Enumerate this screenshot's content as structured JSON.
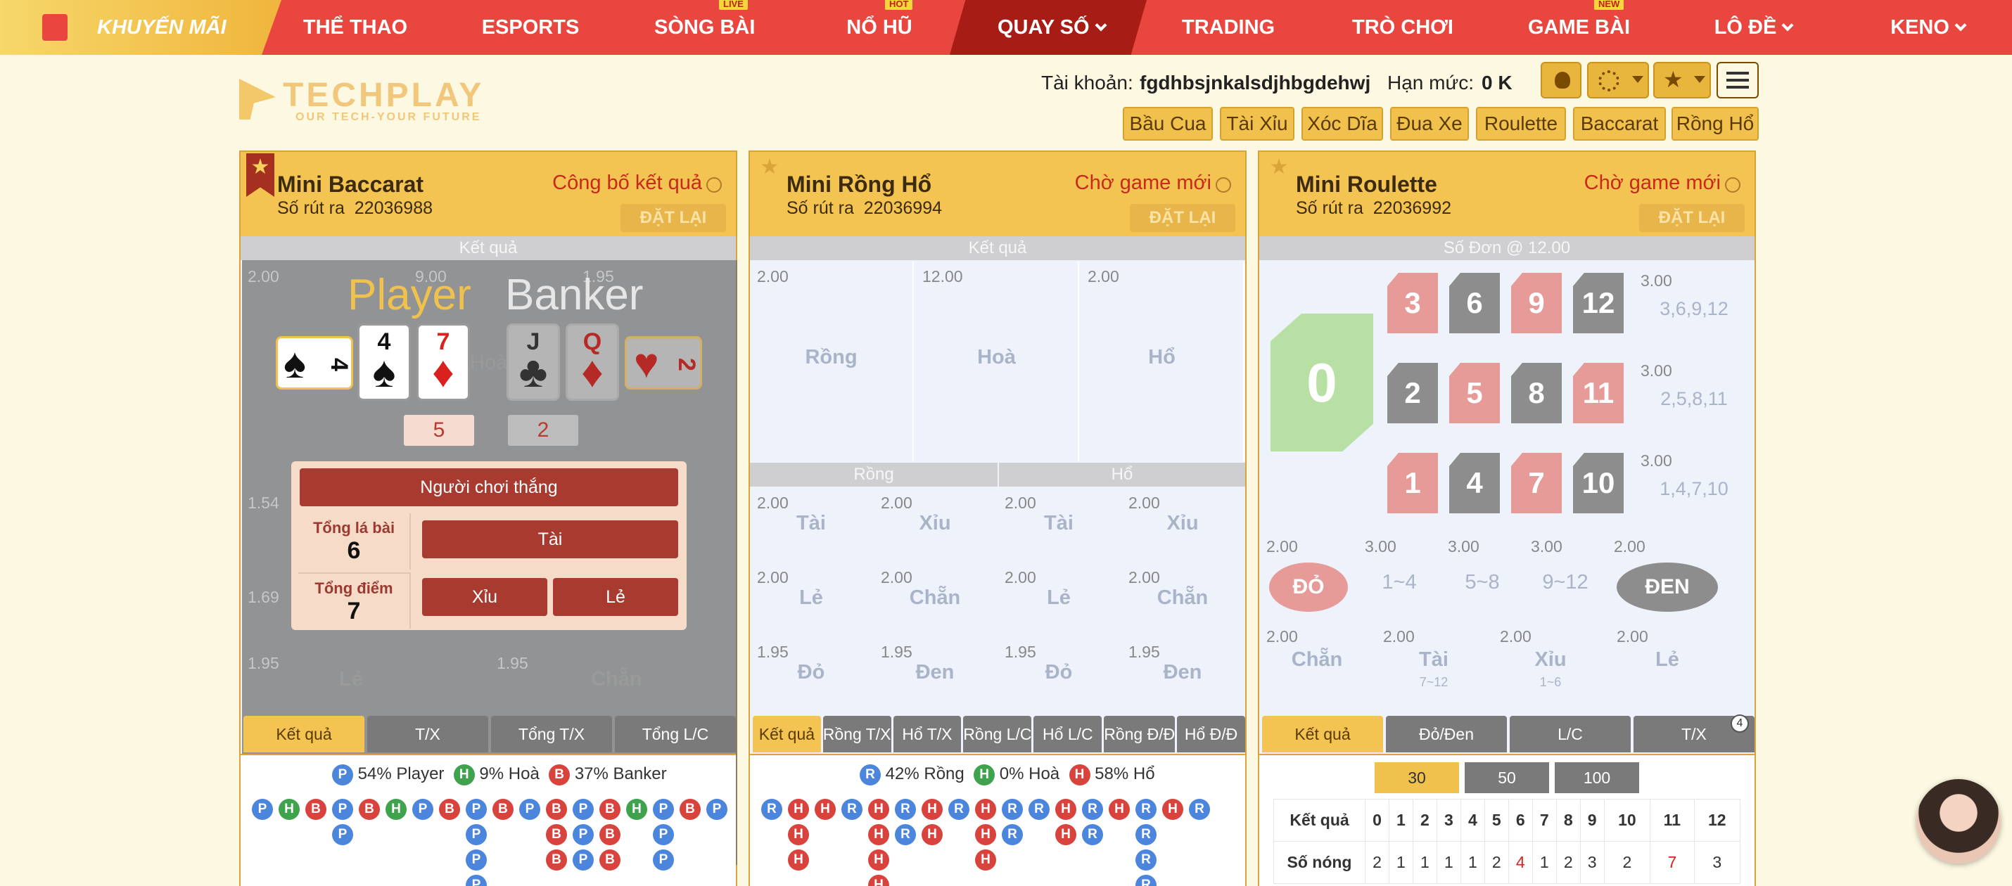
{
  "nav": {
    "promo": "KHUYẾN MÃI",
    "items": [
      "THỂ THAO",
      "ESPORTS",
      "SÒNG BÀI",
      "NỔ HŨ",
      "QUAY SỐ",
      "TRADING",
      "TRÒ CHƠI",
      "GAME BÀI",
      "LÔ ĐỀ",
      "KENO"
    ],
    "badges": {
      "live": "LIVE",
      "hot": "HOT",
      "new": "NEW"
    }
  },
  "logo": {
    "name": "TECHPLAY",
    "tagline": "OUR TECH-YOUR FUTURE"
  },
  "account": {
    "label": "Tài khoản:",
    "username": "fgdhbsjnkalsdjhbgdehwj",
    "limit_label": "Hạn mức:",
    "limit_value": "0 K"
  },
  "games": [
    "Bầu Cua",
    "Tài Xỉu",
    "Xóc Dĩa",
    "Đua Xe",
    "Roulette",
    "Baccarat",
    "Rồng Hổ"
  ],
  "baccarat": {
    "title": "Mini Baccarat",
    "round_label": "Số rút ra",
    "round": "22036988",
    "status": "Công bố kết quả",
    "reset": "ĐẶT LẠI",
    "result_bar": "Kết quả",
    "odds_top": [
      "2.00",
      "9.00",
      "1.95"
    ],
    "player": "Player",
    "banker": "Banker",
    "player_cards": [
      {
        "rank": "4",
        "suit": "♠",
        "color": "blk"
      },
      {
        "rank": "4",
        "suit": "♠",
        "color": "blk"
      },
      {
        "rank": "7",
        "suit": "♦",
        "color": "red"
      }
    ],
    "banker_cards": [
      {
        "rank": "J",
        "suit": "♣",
        "color": "blk"
      },
      {
        "rank": "Q",
        "suit": "♦",
        "color": "red"
      },
      {
        "rank": "2",
        "suit": "♥",
        "color": "red"
      }
    ],
    "player_score": "5",
    "banker_score": "2",
    "hoa_label": "Hoà",
    "odds_mid": [
      "1.54",
      "1.69"
    ],
    "odds_bottom": [
      "1.95",
      "1.95"
    ],
    "bottom_labels": [
      "Lẻ",
      "Chẵn"
    ],
    "popup": {
      "winner": "Người chơi thắng",
      "cards_label": "Tổng lá bài",
      "cards_value": "6",
      "points_label": "Tổng điểm",
      "points_value": "7",
      "tai": "Tài",
      "xiu": "Xỉu",
      "le": "Lẻ"
    },
    "tabs": [
      "Kết quả",
      "T/X",
      "Tổng T/X",
      "Tổng L/C"
    ],
    "stats": {
      "p_badge": "P",
      "p": "54% Player",
      "h_badge": "H",
      "h": "9% Hoà",
      "b_badge": "B",
      "b": "37% Banker"
    }
  },
  "dragon": {
    "title": "Mini Rồng Hổ",
    "round_label": "Số rút ra",
    "round": "22036994",
    "status": "Chờ game mới",
    "reset": "ĐẶT LẠI",
    "result_bar": "Kết quả",
    "main": [
      {
        "odd": "2.00",
        "label": "Rồng"
      },
      {
        "odd": "12.00",
        "label": "Hoà"
      },
      {
        "odd": "2.00",
        "label": "Hổ"
      }
    ],
    "sub_heads": [
      "Rồng",
      "Hổ"
    ],
    "sub_rows": [
      [
        {
          "odd": "2.00",
          "label": "Tài"
        },
        {
          "odd": "2.00",
          "label": "Xỉu"
        },
        {
          "odd": "2.00",
          "label": "Tài"
        },
        {
          "odd": "2.00",
          "label": "Xỉu"
        }
      ],
      [
        {
          "odd": "2.00",
          "label": "Lẻ"
        },
        {
          "odd": "2.00",
          "label": "Chẵn"
        },
        {
          "odd": "2.00",
          "label": "Lẻ"
        },
        {
          "odd": "2.00",
          "label": "Chẵn"
        }
      ],
      [
        {
          "odd": "1.95",
          "label": "Đỏ"
        },
        {
          "odd": "1.95",
          "label": "Đen"
        },
        {
          "odd": "1.95",
          "label": "Đỏ"
        },
        {
          "odd": "1.95",
          "label": "Đen"
        }
      ]
    ],
    "tabs": [
      "Kết quả",
      "Rồng T/X",
      "Hổ T/X",
      "Rồng L/C",
      "Hổ L/C",
      "Rồng Đ/Đ",
      "Hổ Đ/Đ"
    ],
    "stats": {
      "r_badge": "R",
      "r": "42% Rồng",
      "h_badge": "H",
      "h": "0% Hoà",
      "t_badge": "H",
      "t": "58% Hổ"
    }
  },
  "roulette": {
    "title": "Mini Roulette",
    "round_label": "Số rút ra",
    "round": "22036992",
    "status": "Chờ game mới",
    "reset": "ĐẶT LẠI",
    "result_bar": "Số Đơn @ 12.00",
    "zero": "0",
    "rows": [
      {
        "nums": [
          {
            "n": "3",
            "c": "rred"
          },
          {
            "n": "6",
            "c": "rgray"
          },
          {
            "n": "9",
            "c": "rred"
          },
          {
            "n": "12",
            "c": "rgray"
          }
        ],
        "odd": "3.00",
        "label": "3,6,9,12"
      },
      {
        "nums": [
          {
            "n": "2",
            "c": "rgray"
          },
          {
            "n": "5",
            "c": "rred"
          },
          {
            "n": "8",
            "c": "rgray"
          },
          {
            "n": "11",
            "c": "rred"
          }
        ],
        "odd": "3.00",
        "label": "2,5,8,11"
      },
      {
        "nums": [
          {
            "n": "1",
            "c": "rred"
          },
          {
            "n": "4",
            "c": "rgray"
          },
          {
            "n": "7",
            "c": "rred"
          },
          {
            "n": "10",
            "c": "rgray"
          }
        ],
        "odd": "3.00",
        "label": "1,4,7,10"
      }
    ],
    "bets1": [
      {
        "odd": "2.00",
        "label": "ĐỎ"
      },
      {
        "odd": "3.00",
        "label": "1~4"
      },
      {
        "odd": "3.00",
        "label": "5~8"
      },
      {
        "odd": "3.00",
        "label": "9~12"
      },
      {
        "odd": "2.00",
        "label": "ĐEN"
      }
    ],
    "bets2": [
      {
        "odd": "2.00",
        "label": "Chẵn",
        "sub": ""
      },
      {
        "odd": "2.00",
        "label": "Tài",
        "sub": "7~12"
      },
      {
        "odd": "2.00",
        "label": "Xỉu",
        "sub": "1~6"
      },
      {
        "odd": "2.00",
        "label": "Lẻ",
        "sub": ""
      }
    ],
    "tabs": [
      "Kết quả",
      "Đỏ/Đen",
      "L/C",
      "T/X"
    ],
    "tab_badge": "4",
    "counts": [
      "30",
      "50",
      "100"
    ],
    "table_head": "Kết quả",
    "table_nums": [
      "0",
      "1",
      "2",
      "3",
      "4",
      "5",
      "6",
      "7",
      "8",
      "9",
      "10",
      "11",
      "12"
    ],
    "hot_label": "Số nóng",
    "hot": [
      "2",
      "1",
      "1",
      "1",
      "1",
      "2",
      "4",
      "1",
      "2",
      "3",
      "2",
      "7",
      "3"
    ]
  },
  "colors": {
    "nav": "#e8463e",
    "gold": "#f3c451",
    "accent_red": "#c9281d"
  }
}
